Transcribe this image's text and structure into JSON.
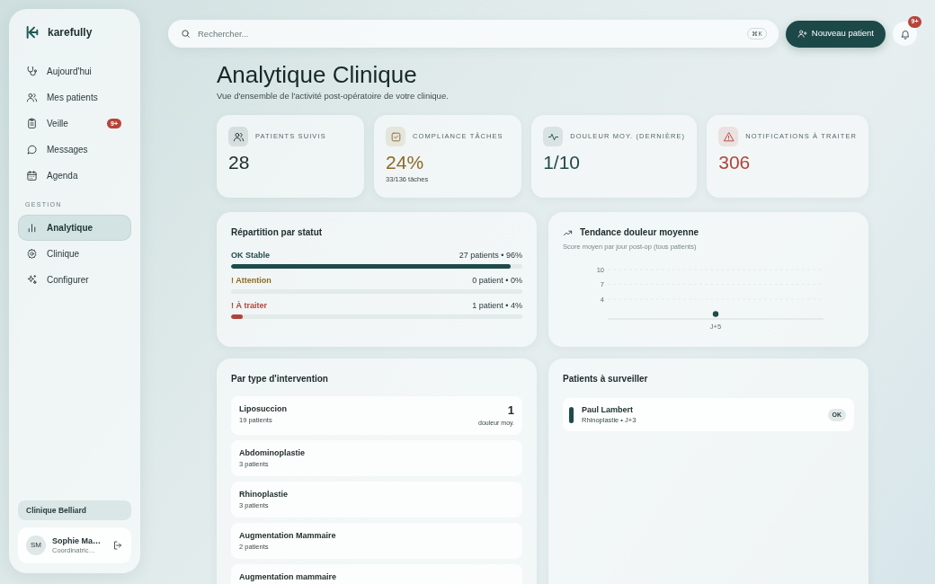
{
  "sidebar": {
    "logo": "karefully",
    "nav": [
      {
        "label": "Aujourd'hui",
        "selected": false
      },
      {
        "label": "Mes patients",
        "selected": false
      },
      {
        "label": "Veille",
        "selected": false,
        "badge": "9+"
      },
      {
        "label": "Messages",
        "selected": false
      },
      {
        "label": "Agenda",
        "selected": false
      }
    ],
    "section_label": "GESTION",
    "section_nav": [
      {
        "label": "Analytique",
        "selected": true
      },
      {
        "label": "Clinique",
        "selected": false
      },
      {
        "label": "Configurer",
        "selected": false
      }
    ],
    "clinic": "Clinique Belliard",
    "user": {
      "initials": "SM",
      "name": "Sophie Ma…",
      "role": "Coordinatric…"
    }
  },
  "topbar": {
    "search": {
      "placeholder": "Rechercher...",
      "shortcut": "⌘K"
    },
    "new_patient_button": "Nouveau patient",
    "notifications_badge": "9+"
  },
  "page": {
    "title": "Analytique Clinique",
    "subtitle": "Vue d'ensemble de l'activité post-opératoire de votre clinique."
  },
  "stats": [
    {
      "label": "PATIENTS SUIVIS",
      "value": "28",
      "color": "#1d2b2b"
    },
    {
      "label": "COMPLIANCE TÂCHES",
      "value": "24%",
      "detail": "33/136 tâches",
      "color": "#8a6a24"
    },
    {
      "label": "DOULEUR MOY. (DERNIÈRE)",
      "value": "1/10",
      "color": "#1f4a48"
    },
    {
      "label": "NOTIFICATIONS À TRAITER",
      "value": "306",
      "color": "#b0443a"
    }
  ],
  "status_breakdown": {
    "title": "Répartition par statut",
    "items": [
      {
        "label": "OK Stable",
        "count": "27 patients • 96%",
        "level": 0.96,
        "color": "#1f4a4a"
      },
      {
        "label": "! Attention",
        "count": "0 patient • 0%",
        "level": 0,
        "color": "#8a6a24"
      },
      {
        "label": "! À traiter",
        "count": "1 patient • 4%",
        "level": 0.04,
        "color": "#b0443a"
      }
    ]
  },
  "pain_trend": {
    "title": "Tendance douleur moyenne",
    "subtitle": "Score moyen par jour post-op (tous patients)",
    "chart_data": {
      "type": "line",
      "marker": true,
      "categories": [
        "J+5"
      ],
      "values": [
        1
      ],
      "ylim": [
        0,
        10
      ],
      "yticks": [
        4,
        7,
        10
      ]
    }
  },
  "interventions": {
    "title": "Par type d'intervention",
    "items": [
      {
        "name": "Liposuccion",
        "patients": "19 patients",
        "value": "1",
        "value_label": "douleur moy."
      },
      {
        "name": "Abdominoplastie",
        "patients": "3 patients"
      },
      {
        "name": "Rhinoplastie",
        "patients": "3 patients"
      },
      {
        "name": "Augmentation Mammaire",
        "patients": "2 patients"
      },
      {
        "name": "Augmentation mammaire"
      }
    ]
  },
  "watch": {
    "title": "Patients à surveiller",
    "patients": [
      {
        "name": "Paul Lambert",
        "detail": "Rhinoplastie • J+3",
        "status": "OK",
        "color": "#1f4a4a"
      }
    ]
  }
}
